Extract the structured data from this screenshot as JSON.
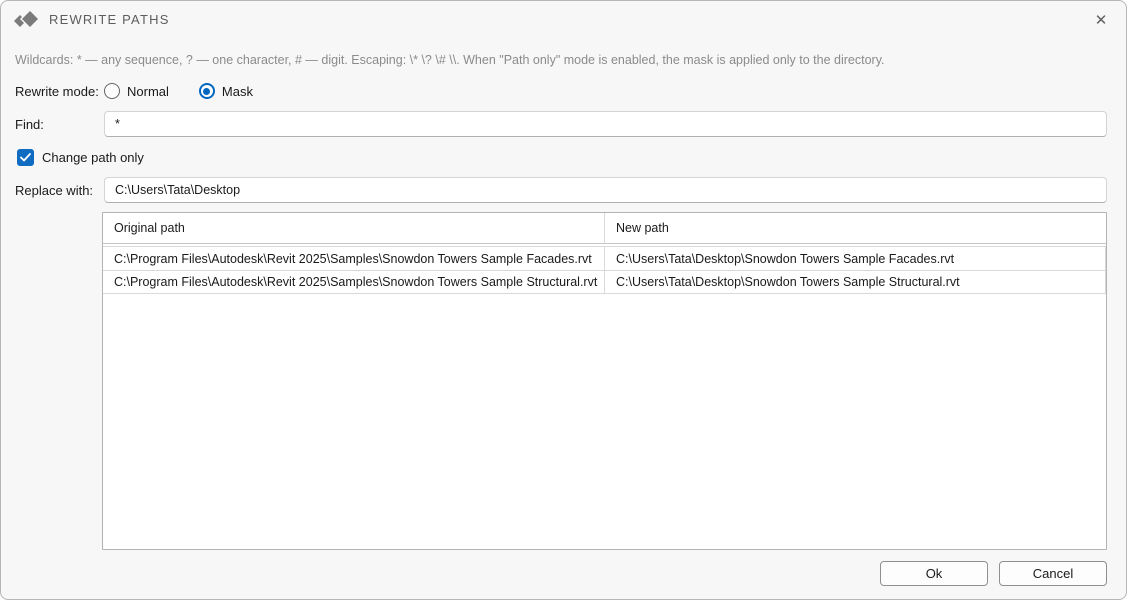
{
  "window": {
    "title": "REWRITE PATHS",
    "close_glyph": "✕"
  },
  "help": {
    "text": "Wildcards: * — any sequence, ? — one character, # — digit. Escaping: \\* \\? \\# \\\\. When \"Path only\" mode is enabled, the mask is applied only to the directory."
  },
  "rewrite_mode": {
    "label": "Rewrite mode:",
    "options": [
      {
        "label": "Normal",
        "selected": false
      },
      {
        "label": "Mask",
        "selected": true
      }
    ]
  },
  "find": {
    "label": "Find:",
    "value": "*"
  },
  "path_only": {
    "label": "Change path only",
    "checked": true
  },
  "replace": {
    "label": "Replace with:",
    "value": "C:\\Users\\Tata\\Desktop"
  },
  "table": {
    "columns": [
      "Original path",
      "New path"
    ],
    "rows": [
      {
        "original": "C:\\Program Files\\Autodesk\\Revit 2025\\Samples\\Snowdon Towers Sample Facades.rvt",
        "new": "C:\\Users\\Tata\\Desktop\\Snowdon Towers Sample Facades.rvt"
      },
      {
        "original": "C:\\Program Files\\Autodesk\\Revit 2025\\Samples\\Snowdon Towers Sample Structural.rvt",
        "new": "C:\\Users\\Tata\\Desktop\\Snowdon Towers Sample Structural.rvt"
      }
    ]
  },
  "buttons": {
    "ok": "Ok",
    "cancel": "Cancel"
  },
  "colors": {
    "accent": "#0067c0",
    "title_gray": "#5d5d5d",
    "help_gray": "#8b8b8b",
    "logo_gray": "#7b7b7b"
  }
}
